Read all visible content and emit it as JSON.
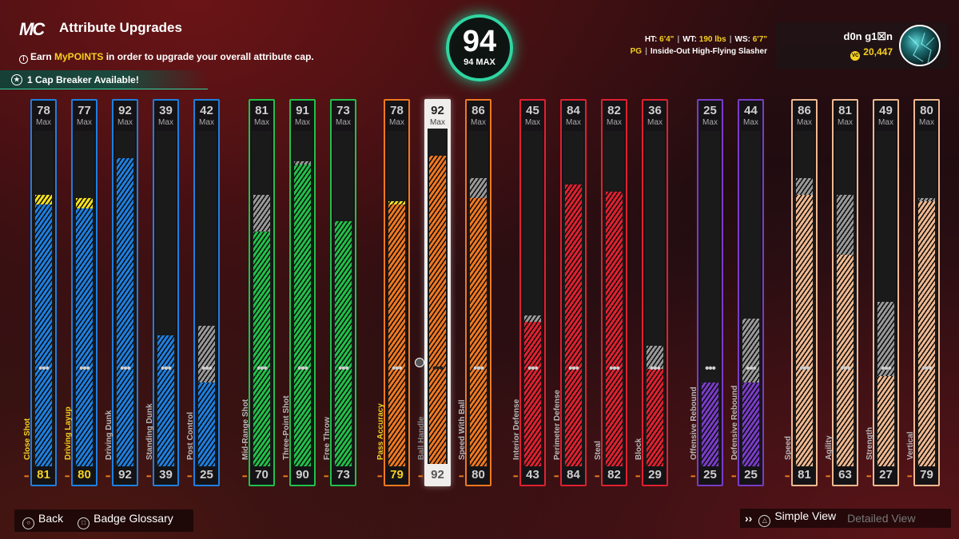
{
  "header": {
    "logo": "MC",
    "title": "Attribute Upgrades",
    "info_prefix": "Earn ",
    "info_highlight": "MyPOINTS",
    "info_suffix": " in order to upgrade your overall attribute cap.",
    "cap_breaker": "1 Cap Breaker Available!"
  },
  "overall": {
    "value": "94",
    "max_label": "94 MAX"
  },
  "bio": {
    "ht_label": "HT:",
    "ht": "6'4\"",
    "wt_label": "WT:",
    "wt": "190 lbs",
    "ws_label": "WS:",
    "ws": "6'7\"",
    "position": "PG",
    "archetype": "Inside-Out High-Flying Slasher"
  },
  "profile": {
    "name": "d0n g1☒n",
    "coins": "20,447"
  },
  "attributes": [
    {
      "name": "Close Shot",
      "cur": 81,
      "max": 78,
      "color": "#1e7fe0",
      "ext": "#f5e020",
      "hl": true
    },
    {
      "name": "Driving Layup",
      "cur": 80,
      "max": 77,
      "color": "#1e7fe0",
      "ext": "#f5e020",
      "hl": true
    },
    {
      "name": "Driving Dunk",
      "cur": 92,
      "max": 92,
      "color": "#1e7fe0",
      "ext": "",
      "hl": false
    },
    {
      "name": "Standing Dunk",
      "cur": 39,
      "max": 39,
      "color": "#1e7fe0",
      "ext": "",
      "hl": false
    },
    {
      "name": "Post Control",
      "cur": 25,
      "max": 42,
      "color": "#1e7fe0",
      "ext": "#999999",
      "hl": false
    },
    {
      "name": "Mid-Range Shot",
      "cur": 70,
      "max": 81,
      "color": "#22c04a",
      "ext": "#999999",
      "hl": false
    },
    {
      "name": "Three-Point Shot",
      "cur": 90,
      "max": 91,
      "color": "#22c04a",
      "ext": "#999999",
      "hl": false
    },
    {
      "name": "Free Throw",
      "cur": 73,
      "max": 73,
      "color": "#22c04a",
      "ext": "",
      "hl": false
    },
    {
      "name": "Pass Accuracy",
      "cur": 79,
      "max": 78,
      "color": "#f07820",
      "ext": "#f5e020",
      "hl": true
    },
    {
      "name": "Ball Handle",
      "cur": 92,
      "max": 92,
      "color": "#f07820",
      "ext": "",
      "hl": false
    },
    {
      "name": "Speed With Ball",
      "cur": 80,
      "max": 86,
      "color": "#f07820",
      "ext": "#999999",
      "hl": false
    },
    {
      "name": "Interior Defense",
      "cur": 43,
      "max": 45,
      "color": "#e02030",
      "ext": "#999999",
      "hl": false
    },
    {
      "name": "Perimeter Defense",
      "cur": 84,
      "max": 84,
      "color": "#e02030",
      "ext": "",
      "hl": false
    },
    {
      "name": "Steal",
      "cur": 82,
      "max": 82,
      "color": "#e02030",
      "ext": "",
      "hl": false
    },
    {
      "name": "Block",
      "cur": 29,
      "max": 36,
      "color": "#e02030",
      "ext": "#999999",
      "hl": false
    },
    {
      "name": "Offensive Rebound",
      "cur": 25,
      "max": 25,
      "color": "#7a3cc8",
      "ext": "",
      "hl": false
    },
    {
      "name": "Defensive Rebound",
      "cur": 25,
      "max": 44,
      "color": "#7a3cc8",
      "ext": "#999999",
      "hl": false
    },
    {
      "name": "Speed",
      "cur": 81,
      "max": 86,
      "color": "#f0b890",
      "ext": "#999999",
      "hl": false
    },
    {
      "name": "Agility",
      "cur": 63,
      "max": 81,
      "color": "#f0b890",
      "ext": "#999999",
      "hl": false
    },
    {
      "name": "Strength",
      "cur": 27,
      "max": 49,
      "color": "#f0b890",
      "ext": "#999999",
      "hl": false
    },
    {
      "name": "Vertical",
      "cur": 79,
      "max": 80,
      "color": "#f0b890",
      "ext": "#999999",
      "hl": false
    }
  ],
  "max_text": "Max",
  "footer": {
    "back": "Back",
    "glossary": "Badge Glossary",
    "simple_view": "Simple View",
    "detailed_view": "Detailed View"
  }
}
